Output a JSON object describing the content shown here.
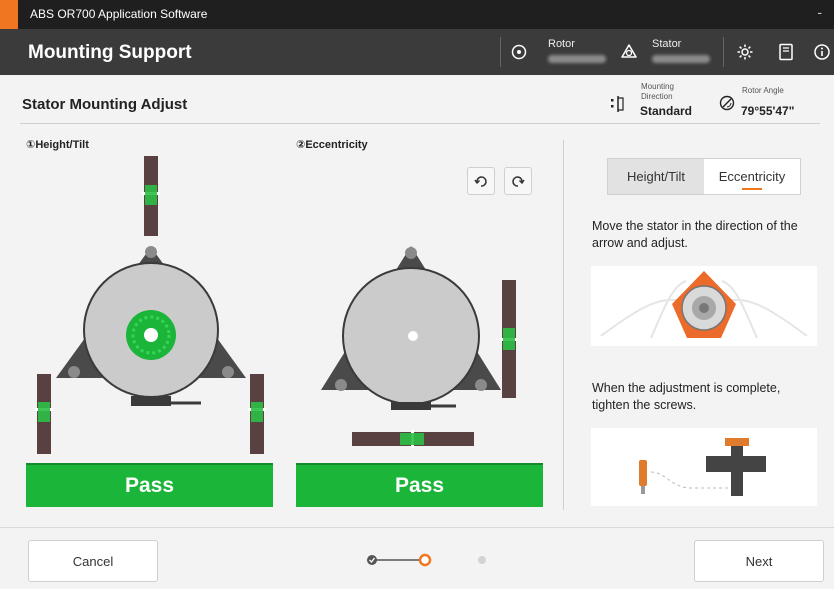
{
  "window": {
    "title": "ABS OR700 Application Software",
    "minimize": "-"
  },
  "header": {
    "title": "Mounting Support",
    "rotor_label": "Rotor",
    "stator_label": "Stator"
  },
  "subheader": {
    "title": "Stator Mounting Adjust",
    "mounting_direction_label_1": "Mounting",
    "mounting_direction_label_2": "Direction",
    "mounting_direction_value": "Standard",
    "rotor_angle_label": "Rotor Angle",
    "rotor_angle_value": "79°55'47\""
  },
  "panels": {
    "height_tilt": {
      "label": "①Height/Tilt",
      "status": "Pass"
    },
    "eccentricity": {
      "label": "②Eccentricity",
      "status": "Pass"
    }
  },
  "side": {
    "tabs": [
      {
        "label": "Height/Tilt",
        "active": false
      },
      {
        "label": "Eccentricity",
        "active": true
      }
    ],
    "instruction_1": "Move the stator in the direction of the arrow and adjust.",
    "instruction_2": "When the adjustment is complete, tighten the screws."
  },
  "footer": {
    "cancel": "Cancel",
    "next": "Next",
    "steps": [
      {
        "state": "done"
      },
      {
        "state": "current"
      },
      {
        "state": "todo"
      }
    ]
  },
  "colors": {
    "accent": "#f07622",
    "pass": "#1bb53a",
    "header": "#3b3b3b",
    "titlebar": "#1f1f1f"
  }
}
